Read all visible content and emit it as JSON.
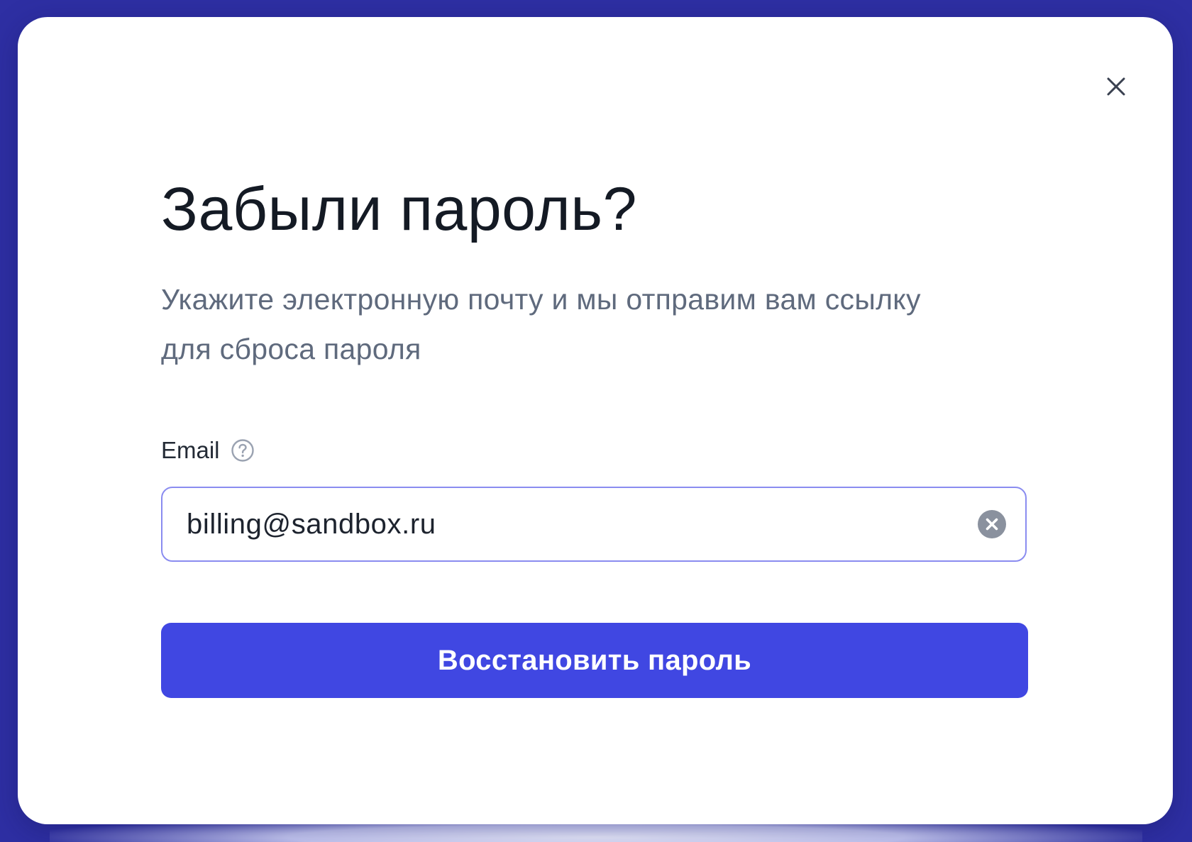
{
  "dialog": {
    "title": "Забыли пароль?",
    "subtitle": "Укажите электронную почту и мы отправим вам ссылку для сброса пароля",
    "close_icon": "close-icon"
  },
  "email_field": {
    "label": "Email",
    "help_icon": "question-circle-icon",
    "value": "billing@sandbox.ru",
    "clear_icon": "clear-circle-icon"
  },
  "submit": {
    "label": "Восстановить пароль"
  },
  "colors": {
    "backdrop": "#2e2fa3",
    "accent": "#4047e2",
    "input_border": "#8a8cf0",
    "title_text": "#141a24",
    "subtitle_text": "#5f6a7d"
  }
}
